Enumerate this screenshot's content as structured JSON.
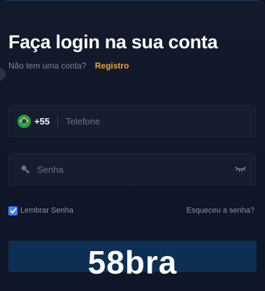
{
  "login": {
    "title": "Faça login na sua conta",
    "subtitle": "Não tem uma conta?",
    "register_link": "Registro"
  },
  "phone": {
    "flag_icon": "brazil-flag-icon",
    "dial_code": "+55",
    "placeholder": "Telefone",
    "value": ""
  },
  "password": {
    "key_icon": "key-icon",
    "placeholder": "Senha",
    "value": "",
    "toggle_icon": "eye-closed-icon"
  },
  "options": {
    "remember_label": "Lembrar Senha",
    "remember_checked": true,
    "forgot_link": "Esqueceu a senha?"
  },
  "brand": {
    "watermark": "58bra"
  },
  "colors": {
    "accent": "#f5a623",
    "checkbox": "#3b82f6",
    "button": "#0e2f54",
    "background": "#131a2b"
  }
}
